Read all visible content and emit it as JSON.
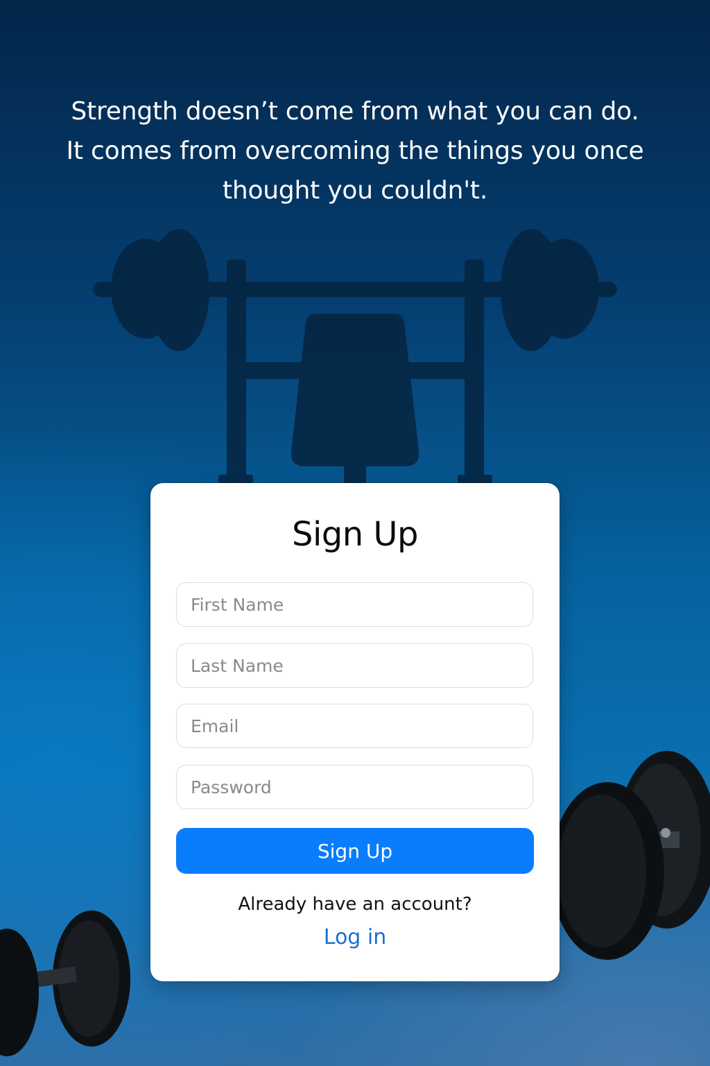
{
  "quote": {
    "line1": "Strength doesn’t come from what you can do.",
    "line2": "It comes from overcoming the things you once",
    "line3": "thought you couldn't."
  },
  "form": {
    "title": "Sign Up",
    "first_name_placeholder": "First Name",
    "last_name_placeholder": "Last Name",
    "email_placeholder": "Email",
    "password_placeholder": "Password",
    "submit_label": "Sign Up",
    "already_text": "Already have an account?",
    "login_label": "Log in"
  },
  "colors": {
    "accent": "#0a7dfc",
    "link": "#1a6fd0",
    "background_top": "#03264a",
    "background_bottom": "#2f6ea6",
    "silhouette": "#062440"
  },
  "icons": {
    "background_illustration": "bench-press-icon",
    "dumbbell_left": "dumbbell-icon",
    "dumbbell_right": "dumbbell-icon"
  }
}
